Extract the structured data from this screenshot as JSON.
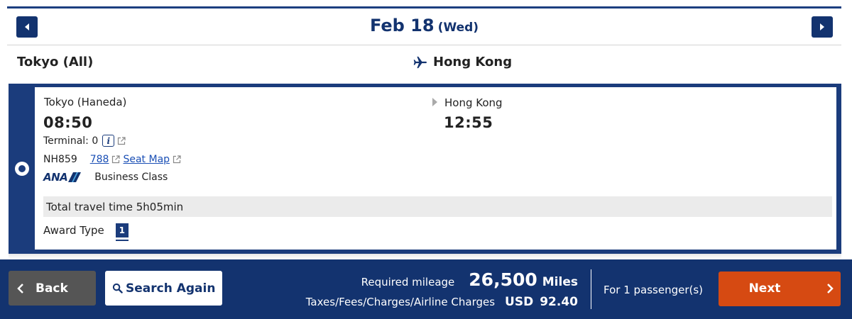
{
  "date_bar": {
    "date": "Feb 18",
    "weekday": "(Wed)",
    "prev_icon": "caret-left-icon",
    "next_icon": "caret-right-icon"
  },
  "route": {
    "origin": "Tokyo (All)",
    "destination": "Hong Kong",
    "icon": "airplane-icon"
  },
  "flight": {
    "selected": true,
    "departure": {
      "city": "Tokyo (Haneda)",
      "time": "08:50",
      "terminal_label": "Terminal: 0"
    },
    "arrival": {
      "city": "Hong Kong",
      "time": "12:55"
    },
    "flight_number": "NH859",
    "aircraft": "788",
    "seat_map_label": "Seat Map",
    "airline_logo_text": "ANA",
    "cabin_class": "Business Class",
    "travel_time": "Total travel time 5h05min",
    "award_type_label": "Award Type",
    "award_type_value": "1"
  },
  "footer": {
    "back_label": "Back",
    "search_again_label": "Search Again",
    "required_mileage_label": "Required mileage",
    "required_mileage_value": "26,500",
    "mileage_unit": "Miles",
    "taxes_label": "Taxes/Fees/Charges/Airline Charges",
    "taxes_currency": "USD",
    "taxes_value": "92.40",
    "passengers_label": "For 1 passenger(s)",
    "next_label": "Next"
  },
  "colors": {
    "navy": "#13336f",
    "card_border": "#1b3c7c",
    "next_button": "#d64a12",
    "back_button": "#555555",
    "link": "#1a4fb5"
  }
}
